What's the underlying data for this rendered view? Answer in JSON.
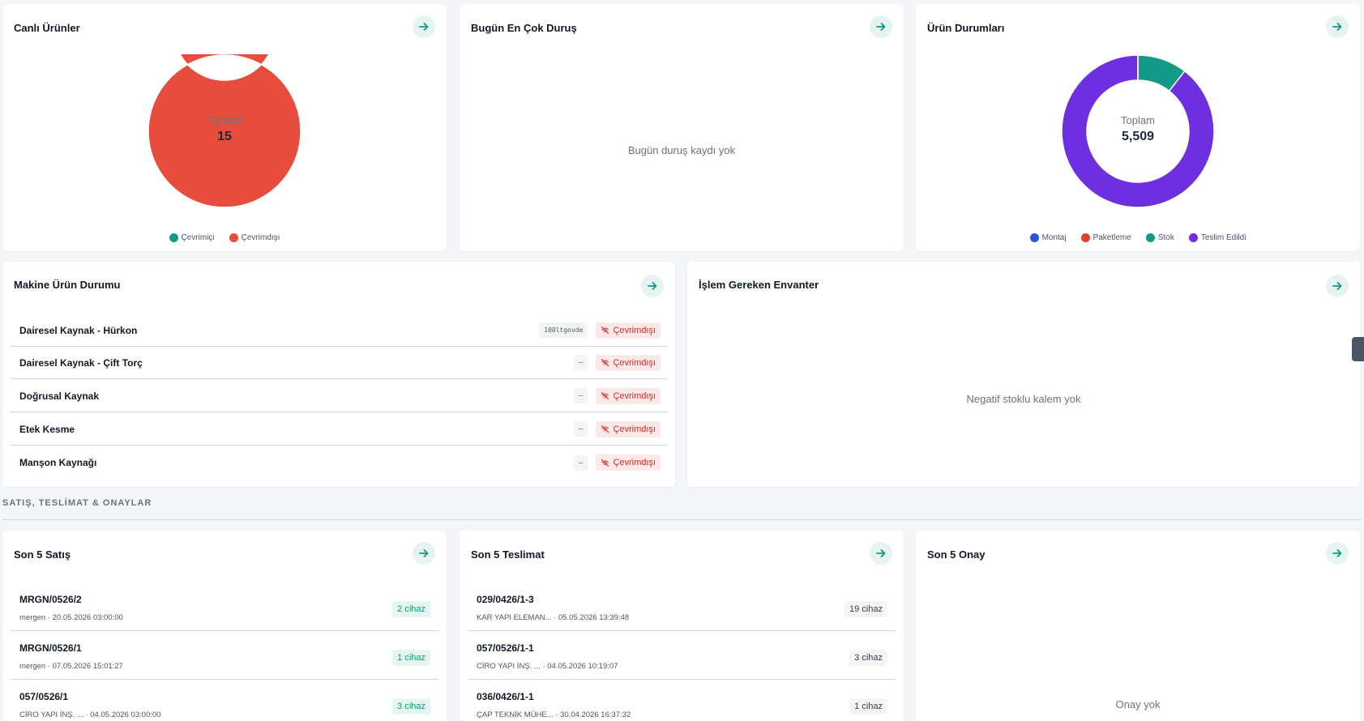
{
  "cards": {
    "live_products": {
      "title": "Canlı Ürünler",
      "total_label": "Toplam",
      "total_value": "15",
      "segments": [
        {
          "label": "Çevrimiçi",
          "value": 0,
          "color": "#139a86"
        },
        {
          "label": "Çevrimdışı",
          "value": 15,
          "color": "#e84c3d"
        }
      ]
    },
    "top_downtime": {
      "title": "Bugün En Çok Duruş",
      "empty": "Bugün duruş kaydı yok"
    },
    "product_status": {
      "title": "Ürün Durumları",
      "total_label": "Toplam",
      "total_value": "5,509",
      "segments": [
        {
          "label": "Montaj",
          "value": 0,
          "color": "#2b55d9"
        },
        {
          "label": "Paketleme",
          "value": 0,
          "color": "#d9452a"
        },
        {
          "label": "Stok",
          "value": 580,
          "color": "#139a86"
        },
        {
          "label": "Teslim Edildi",
          "value": 4929,
          "color": "#6d2fe0"
        }
      ]
    },
    "machine_status": {
      "title": "Makine Ürün Durumu",
      "rows": [
        {
          "name": "Dairesel Kaynak - Hürkon",
          "chip": "100ltgovde",
          "status": "Çevrimdışı"
        },
        {
          "name": "Dairesel Kaynak - Çift Torç",
          "chip": "–",
          "status": "Çevrimdışı"
        },
        {
          "name": "Doğrusal Kaynak",
          "chip": "–",
          "status": "Çevrimdışı"
        },
        {
          "name": "Etek Kesme",
          "chip": "–",
          "status": "Çevrimdışı"
        },
        {
          "name": "Manşon Kaynağı",
          "chip": "–",
          "status": "Çevrimdışı"
        }
      ]
    },
    "inventory": {
      "title": "İşlem Gereken Envanter",
      "empty": "Negatif stoklu kalem yok"
    },
    "section_label": "SATIŞ, TESLİMAT & ONAYLAR",
    "sales": {
      "title": "Son 5 Satış",
      "items": [
        {
          "id": "MRGN/0526/2",
          "sub": "mergen · 20.05.2026 03:00:00",
          "count": "2 cihaz"
        },
        {
          "id": "MRGN/0526/1",
          "sub": "mergen · 07.05.2026 15:01:27",
          "count": "1 cihaz"
        },
        {
          "id": "057/0526/1",
          "sub": "CİRO YAPI İNŞ. ... · 04.05.2026 03:00:00",
          "count": "3 cihaz"
        }
      ]
    },
    "deliveries": {
      "title": "Son 5 Teslimat",
      "items": [
        {
          "id": "029/0426/1-3",
          "sub": "KAR YAPI ELEMAN... · 05.05.2026 13:39:48",
          "count": "19 cihaz"
        },
        {
          "id": "057/0526/1-1",
          "sub": "CİRO YAPI İNŞ. ... · 04.05.2026 10:19:07",
          "count": "3 cihaz"
        },
        {
          "id": "036/0426/1-1",
          "sub": "ÇAP TEKNİK MÜHE... · 30.04.2026 16:37:32",
          "count": "1 cihaz"
        }
      ]
    },
    "approvals": {
      "title": "Son 5 Onay",
      "empty": "Onay yok"
    }
  }
}
